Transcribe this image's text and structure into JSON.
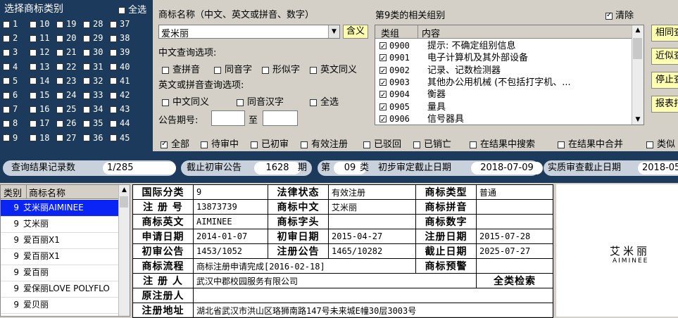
{
  "class_panel": {
    "title": "选择商标类别",
    "select_all": "全选",
    "rows": [
      [
        "1",
        "10",
        "19",
        "28",
        "37"
      ],
      [
        "2",
        "11",
        "20",
        "29",
        "38"
      ],
      [
        "3",
        "12",
        "21",
        "30",
        "39"
      ],
      [
        "4",
        "13",
        "22",
        "31",
        "40"
      ],
      [
        "5",
        "14",
        "23",
        "32",
        "41"
      ],
      [
        "6",
        "15",
        "24",
        "33",
        "42"
      ],
      [
        "7",
        "16",
        "25",
        "34",
        "43"
      ],
      [
        "8",
        "17",
        "26",
        "35",
        "44"
      ],
      [
        "9",
        "18",
        "27",
        "36",
        "45"
      ]
    ],
    "checked": [
      "9"
    ]
  },
  "query": {
    "name_label": "商标名称（中文、英文或拼音、数字）",
    "name_value": "爱米丽",
    "meaning_button": "含义",
    "cn_options_label": "中文查询选项:",
    "cn_options": [
      "查拼音",
      "同音字",
      "形似字",
      "英文同义"
    ],
    "en_options_label": "英文或拼音查询选项:",
    "en_options": [
      "中文同义",
      "同音汉字",
      "全选"
    ],
    "announce_label": "公告期号:",
    "announce_to": "至"
  },
  "groups": {
    "title": "第9类的相关组别",
    "clear_label": "清除",
    "col_group": "类组",
    "col_content": "内容",
    "items": [
      {
        "code": "0900",
        "content": "提示: 不确定组别信息"
      },
      {
        "code": "0901",
        "content": "电子计算机及其外部设备"
      },
      {
        "code": "0902",
        "content": "记录、记数检测器"
      },
      {
        "code": "0903",
        "content": "其他办公用机械 (不包括打字机、..."
      },
      {
        "code": "0904",
        "content": "衡器"
      },
      {
        "code": "0905",
        "content": "量具"
      },
      {
        "code": "0906",
        "content": "信号器具"
      }
    ]
  },
  "side_buttons": [
    "相同查",
    "近似查",
    "停止查",
    "报表打"
  ],
  "filters": [
    "全部",
    "待审中",
    "已初审",
    "有效注册",
    "已驳回",
    "已销亡",
    "在结果中搜索",
    "在结果中合并",
    "类似"
  ],
  "status_bar": {
    "count_label": "查询结果记录数",
    "count_value": "1/285",
    "cutoff_label": "截止初审公告",
    "cutoff_value": "1628",
    "cutoff_unit": "期",
    "class_prefix": "第",
    "class_value": "09",
    "class_suffix": "类",
    "prelim_label": "初步审定截止日期",
    "prelim_value": "2018-07-09",
    "substantive_label": "实质审查截止日期",
    "substantive_value": "2018-05"
  },
  "result_list": {
    "col_class": "类别",
    "col_name": "商标名称",
    "rows": [
      {
        "cls": "9",
        "name": "艾米丽AIMINEE"
      },
      {
        "cls": "9",
        "name": "艾米丽"
      },
      {
        "cls": "9",
        "name": "爱百丽X1"
      },
      {
        "cls": "9",
        "name": "爱百丽X1"
      },
      {
        "cls": "9",
        "name": "爱百丽"
      },
      {
        "cls": "9",
        "name": "爱保丽LOVE POLYFLO"
      },
      {
        "cls": "9",
        "name": "爱贝丽"
      }
    ]
  },
  "detail": {
    "intl_class_label": "国际分类",
    "intl_class": "9",
    "legal_status_label": "法律状态",
    "legal_status": "有效注册",
    "type_label": "商标类型",
    "type": "普通",
    "reg_no_label": "注 册 号",
    "reg_no": "13873739",
    "cn_name_label": "商标中文",
    "cn_name": "艾米丽",
    "pinyin_label": "商标拼音",
    "pinyin": "",
    "en_label": "商标英文",
    "en": "AIMINEE",
    "letters_label": "商标字头",
    "letters": "",
    "digits_label": "商标数字",
    "digits": "",
    "apply_date_label": "申请日期",
    "apply_date": "2014-01-07",
    "prelim_date_label": "初审日期",
    "prelim_date": "2015-04-27",
    "reg_date_label": "注册日期",
    "reg_date": "2015-07-28",
    "prelim_notice_label": "初审公告",
    "prelim_notice": "1453/1052",
    "reg_notice_label": "注册公告",
    "reg_notice": "1465/10282",
    "expiry_label": "截止日期",
    "expiry": "2025-07-27",
    "process_label": "商标流程",
    "process": "商标注册申请完成[2016-02-18]",
    "warning_label": "商标预警",
    "warning": "",
    "registrant_label": "注 册 人",
    "registrant": "武汉中郡校园服务有限公司",
    "all_class_search": "全类检索",
    "orig_registrant_label": "原注册人",
    "orig_registrant": "",
    "address_label": "注册地址",
    "address": "湖北省武汉市洪山区珞狮南路147号未来城E幢30层3003号"
  },
  "logo": {
    "cn": "艾米丽",
    "en": "AIMINEE"
  }
}
